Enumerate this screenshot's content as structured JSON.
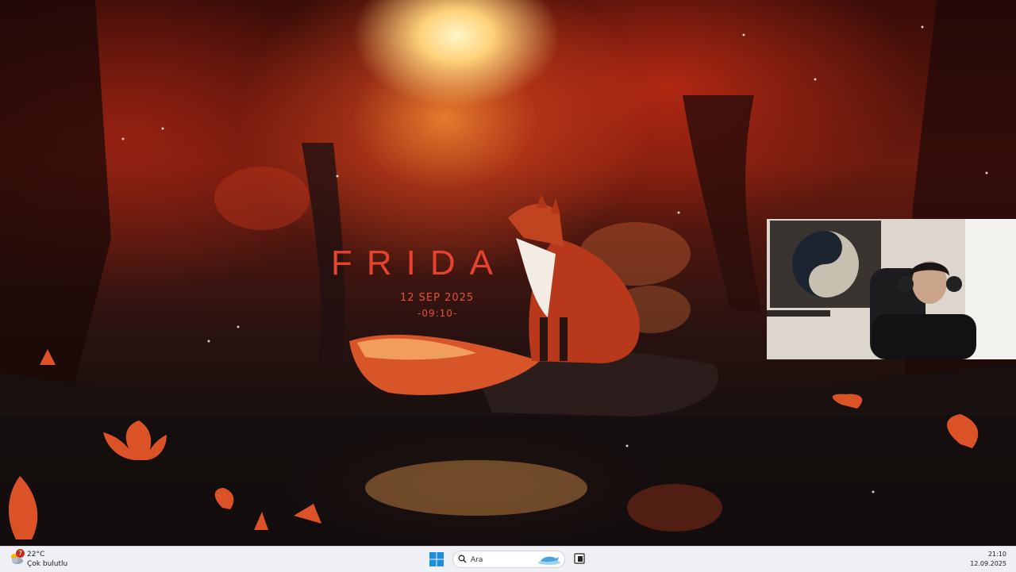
{
  "wallpaper": {
    "clock_widget": {
      "title": "FRIDA",
      "date": "12 SEP 2025",
      "time": "-09:10-"
    }
  },
  "taskbar": {
    "weather": {
      "alert_count": "7",
      "temperature": "22°C",
      "condition": "Çok bulutlu",
      "icon": "cloud-sun-icon"
    },
    "start_icon": "windows-logo-icon",
    "search": {
      "placeholder": "Ara",
      "highlight_icon": "dolphin-icon"
    },
    "taskview_icon": "task-view-icon",
    "tray": {
      "time": "21:10",
      "date": "12.09.2025"
    }
  },
  "colors": {
    "accent": "#e4432e",
    "taskbar_bg": "#eef0f5",
    "windows_blue": "#1e8fe0"
  }
}
